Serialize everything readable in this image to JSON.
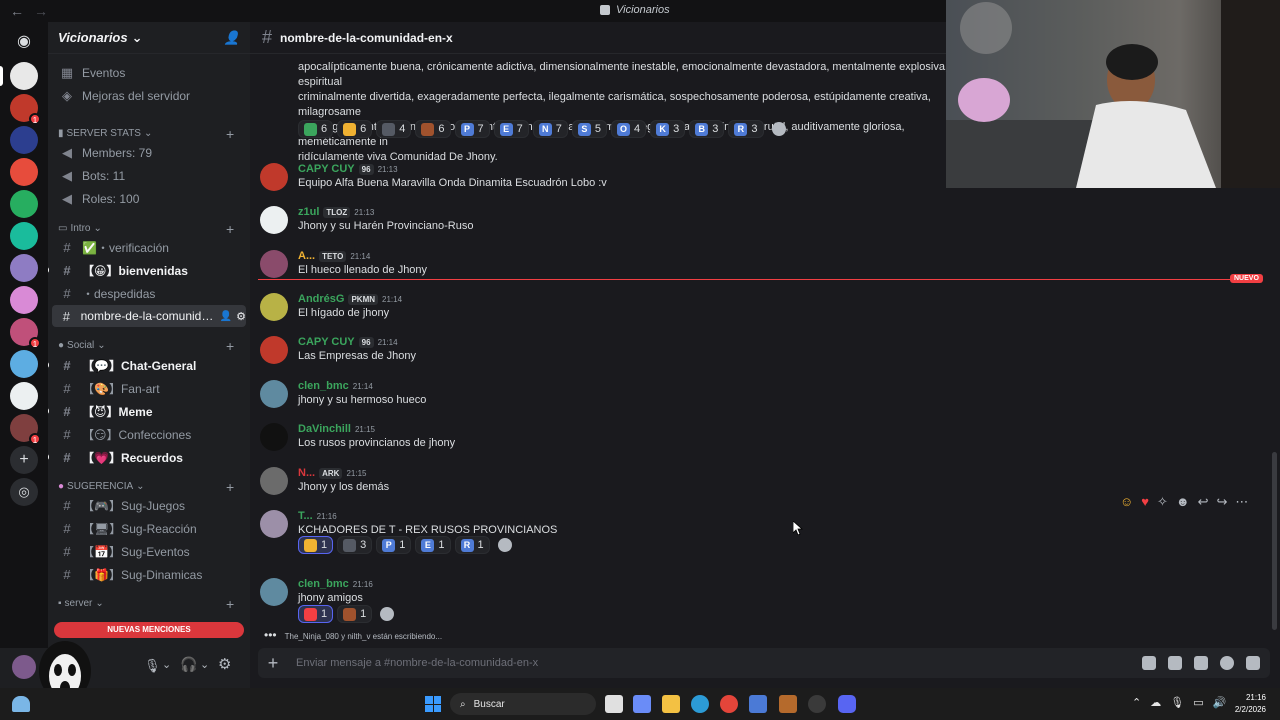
{
  "titlebar": {
    "title": "Vicionarios"
  },
  "server": {
    "name": "Vicionarios",
    "top_items": [
      "Eventos",
      "Mejoras del servidor"
    ],
    "stats_category": "SERVER STATS",
    "stats": [
      "Members: 79",
      "Bots: 11",
      "Roles: 100"
    ],
    "categories": {
      "intro": "Intro",
      "social": "Social",
      "sugerencia": "SUGERENCIA",
      "server": "server"
    },
    "channels": {
      "verificacion": "・verificación",
      "bienvenidas": "bienvenidas",
      "despedidas": "・despedidas",
      "current": "nombre-de-la-comunidad...",
      "chat_general": "Chat-General",
      "fan_art": "Fan-art",
      "meme": "Meme",
      "confecciones": "Confecciones",
      "recuerdos": "Recuerdos",
      "sug_juegos": "Sug-Juegos",
      "sug_reaccion": "Sug-Reacción",
      "sug_eventos": "Sug-Eventos",
      "sug_dinamicas": "Sug-Dinamicas"
    },
    "new_mentions": "NUEVAS MENCIONES"
  },
  "channel": {
    "name": "nombre-de-la-comunidad-en-x"
  },
  "top_text": [
    "apocalípticamente buena, crónicamente adictiva, dimensionalmente inestable, emocionalmente devastadora, mentalmente explosiva, espiritual",
    "criminalmente divertida, exageradamente perfecta, ilegalmente carismática, sospechosamente poderosa, estúpidamente creativa, milagrosame",
    "psicológicamente dominante, socialmente magnética, narrativamente legendaria, visualmente brutal, auditivamente gloriosa, meméticamente in",
    "ridículamente viva Comunidad De Jhony."
  ],
  "top_reactions": [
    {
      "emoji_color": "#3ba55d",
      "count": "6"
    },
    {
      "emoji_color": "#f0b232",
      "count": "6"
    },
    {
      "emoji_color": "#555a64",
      "count": "4"
    },
    {
      "emoji_color": "#a0522d",
      "count": "6"
    },
    {
      "emoji_color": "#4f7bd6",
      "label": "P",
      "count": "7"
    },
    {
      "emoji_color": "#4f7bd6",
      "label": "E",
      "count": "7"
    },
    {
      "emoji_color": "#4f7bd6",
      "label": "N",
      "count": "7"
    },
    {
      "emoji_color": "#4f7bd6",
      "label": "S",
      "count": "5"
    },
    {
      "emoji_color": "#4f7bd6",
      "label": "O",
      "count": "4"
    },
    {
      "emoji_color": "#4f7bd6",
      "label": "K",
      "count": "3"
    },
    {
      "emoji_color": "#4f7bd6",
      "label": "B",
      "count": "3"
    },
    {
      "emoji_color": "#4f7bd6",
      "label": "R",
      "count": "3"
    }
  ],
  "messages": [
    {
      "name": "CAPY CUY",
      "tag": "96",
      "time": "21:13",
      "text": "Equipo Alfa Buena Maravilla Onda Dinamita Escuadrón Lobo :v",
      "color": "#3ba55d"
    },
    {
      "name": "z1ul",
      "tag": "TLOZ",
      "time": "21:13",
      "text": "Jhony y su Harén Provinciano-Ruso",
      "color": "#3ba55d"
    },
    {
      "name": "A...",
      "tag": "TETO",
      "time": "21:14",
      "text": "El hueco llenado de Jhony",
      "color": "#f0b232"
    },
    {
      "name": "AndrésG",
      "tag": "PKMN",
      "time": "21:14",
      "text": "El hígado de jhony",
      "color": "#3ba55d"
    },
    {
      "name": "CAPY CUY",
      "tag": "96",
      "time": "21:14",
      "text": "Las Empresas de Jhony",
      "color": "#3ba55d"
    },
    {
      "name": "clen_bmc",
      "tag": "",
      "time": "21:14",
      "text": "jhony y su hermoso hueco",
      "color": "#3ba55d"
    },
    {
      "name": "DaVinchill",
      "tag": "",
      "time": "21:15",
      "text": "Los rusos provincianos de jhony",
      "color": "#3ba55d"
    },
    {
      "name": "N...",
      "tag": "ARK",
      "time": "21:15",
      "text": "Jhony y los demás",
      "color": "#da373c"
    },
    {
      "name": "T...",
      "tag": "",
      "time": "21:16",
      "text": "KCHADORES DE T - REX RUSOS PROVINCIANOS",
      "color": "#3ba55d"
    },
    {
      "name": "clen_bmc",
      "tag": "",
      "time": "21:16",
      "text": "jhony amigos",
      "color": "#3ba55d"
    }
  ],
  "msg9_reactions": [
    {
      "emoji_color": "#f0b232",
      "count": "1"
    },
    {
      "emoji_color": "#555a64",
      "count": "3"
    },
    {
      "emoji_color": "#4f7bd6",
      "label": "P",
      "count": "1"
    },
    {
      "emoji_color": "#4f7bd6",
      "label": "E",
      "count": "1"
    },
    {
      "emoji_color": "#4f7bd6",
      "label": "R",
      "count": "1"
    }
  ],
  "msg10_reactions": [
    {
      "emoji_color": "#f23f43",
      "count": "1"
    },
    {
      "emoji_color": "#a0522d",
      "count": "1"
    }
  ],
  "new_label": "NUEVO",
  "typing": "The_Ninja_080 y nilth_v están escribiendo...",
  "composer": {
    "placeholder": "Enviar mensaje a #nombre-de-la-comunidad-en-x"
  },
  "taskbar": {
    "search": "Buscar",
    "time": "21:16",
    "date": "2/2/2026"
  }
}
